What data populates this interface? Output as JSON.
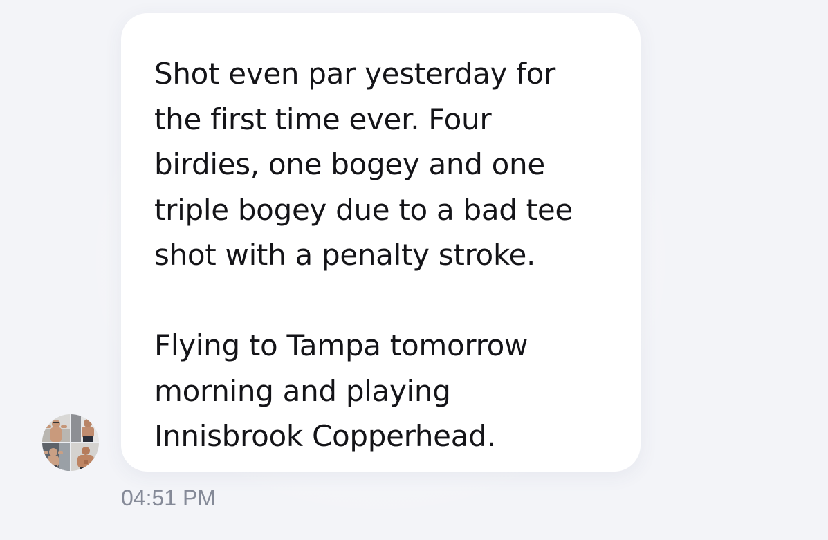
{
  "message": {
    "text": "Shot even par yesterday for\nthe first time ever. Four\nbirdies, one bogey and one\ntriple bogey due to a bad tee\nshot with a penalty stroke.\n\nFlying to Tampa tomorrow\nmorning and playing\nInnisbrook Copperhead.",
    "timestamp": "04:51 PM"
  },
  "avatar": {
    "icon": "collage-avatar",
    "colors": {
      "skin": "#c99a7c",
      "background_light": "#dcdde0",
      "background_dark": "#5a5f66"
    }
  },
  "colors": {
    "page_background": "#f3f4f8",
    "bubble_background": "#ffffff",
    "text": "#141418",
    "timestamp": "#858a98"
  }
}
